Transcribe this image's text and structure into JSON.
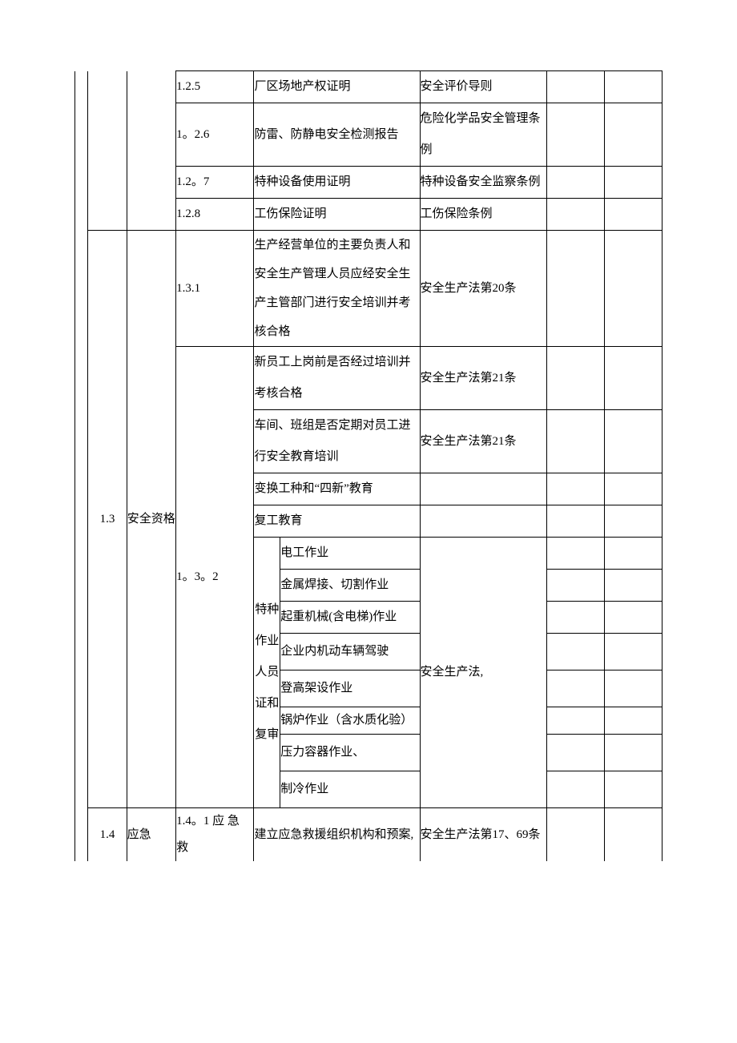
{
  "rows": {
    "r125": {
      "code": "1.2.5",
      "desc": "厂区场地产权证明",
      "law": "安全评价导则"
    },
    "r126": {
      "code": "1。2.6",
      "desc": "防雷、防静电安全检测报告",
      "law": "危险化学品安全管理条例"
    },
    "r127": {
      "code": "1.2。7",
      "desc": "特种设备使用证明",
      "law": "特种设备安全监察条例"
    },
    "r128": {
      "code": "1.2.8",
      "desc": "工伤保险证明",
      "law": "工伤保险条例"
    },
    "r131": {
      "code": "1.3.1",
      "desc": "生产经营单位的主要负责人和安全生产管理人员应经安全生产主管部门进行安全培训并考核合格",
      "law": "安全生产法第20条"
    },
    "r132a": {
      "desc": "新员工上岗前是否经过培训并考核合格",
      "law": "安全生产法第21条"
    },
    "r132b": {
      "desc": "车间、班组是否定期对员工进行安全教育培训",
      "law": "安全生产法第21条"
    },
    "r132c": {
      "desc": "变换工种和“四新”教育"
    },
    "r132d": {
      "desc": "复工教育"
    },
    "sp1": {
      "desc": "电工作业"
    },
    "sp2": {
      "desc": "金属焊接、切割作业"
    },
    "sp3": {
      "desc": "起重机械(含电梯)作业"
    },
    "sp4": {
      "desc": "企业内机动车辆驾驶"
    },
    "sp5": {
      "desc": "登高架设作业"
    },
    "sp6": {
      "desc": "锅炉作业（含水质化验）"
    },
    "sp7": {
      "desc": "压力容器作业、"
    },
    "sp8": {
      "desc": "制冷作业"
    },
    "spLaw": "安全生产法,",
    "r132code": "1。3。2",
    "sec13": {
      "num": "1.3",
      "title": "安全资格"
    },
    "sec14": {
      "num": "1.4",
      "title": "应急",
      "code": "1.4。1 应 急 救",
      "desc": "建立应急救援组织机构和预案,",
      "law": "安全生产法第17、69条"
    },
    "vertLabel": "特种作业人员证和复审"
  }
}
